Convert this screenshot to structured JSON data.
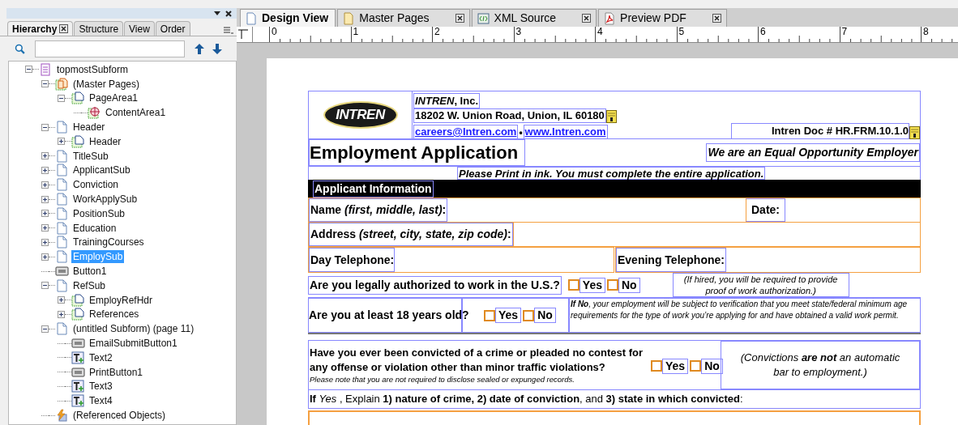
{
  "panel": {
    "tabs": [
      {
        "label": "Hierarchy",
        "selected": true,
        "closable": true
      },
      {
        "label": "Structure",
        "selected": false,
        "closable": false
      },
      {
        "label": "View",
        "selected": false,
        "closable": false
      },
      {
        "label": "Order",
        "selected": false,
        "closable": false
      }
    ],
    "tree": [
      {
        "label": "topmostSubform",
        "kind": "form",
        "expanded": true,
        "selected": false,
        "children": [
          {
            "label": "(Master Pages)",
            "kind": "master",
            "expanded": true,
            "selected": false,
            "children": [
              {
                "label": "PageArea1",
                "kind": "pagearea",
                "expanded": true,
                "selected": false,
                "children": [
                  {
                    "label": "ContentArea1",
                    "kind": "content",
                    "selected": false
                  }
                ]
              }
            ]
          },
          {
            "label": "Header",
            "kind": "subform",
            "expanded": true,
            "selected": false,
            "children": [
              {
                "label": "Header",
                "kind": "pagearea",
                "expanded": false,
                "selected": false
              }
            ]
          },
          {
            "label": "TitleSub",
            "kind": "subform",
            "expanded": false,
            "selected": false
          },
          {
            "label": "ApplicantSub",
            "kind": "subform",
            "expanded": false,
            "selected": false
          },
          {
            "label": "Conviction",
            "kind": "subform",
            "expanded": false,
            "selected": false
          },
          {
            "label": "WorkApplySub",
            "kind": "subform",
            "expanded": false,
            "selected": false
          },
          {
            "label": "PositionSub",
            "kind": "subform",
            "expanded": false,
            "selected": false
          },
          {
            "label": "Education",
            "kind": "subform",
            "expanded": false,
            "selected": false
          },
          {
            "label": "TrainingCourses",
            "kind": "subform",
            "expanded": false,
            "selected": false
          },
          {
            "label": "EmploySub",
            "kind": "subform",
            "expanded": false,
            "selected": true
          },
          {
            "label": "Button1",
            "kind": "button",
            "selected": false
          },
          {
            "label": "RefSub",
            "kind": "subform",
            "expanded": true,
            "selected": false,
            "children": [
              {
                "label": "EmployRefHdr",
                "kind": "pagearea",
                "expanded": false,
                "selected": false
              },
              {
                "label": "References",
                "kind": "pagearea",
                "expanded": false,
                "selected": false
              }
            ]
          },
          {
            "label": "(untitled Subform) (page 11)",
            "kind": "subform",
            "expanded": true,
            "selected": false,
            "children": [
              {
                "label": "EmailSubmitButton1",
                "kind": "button",
                "selected": false
              },
              {
                "label": "Text2",
                "kind": "text",
                "selected": false
              },
              {
                "label": "PrintButton1",
                "kind": "button",
                "selected": false
              },
              {
                "label": "Text3",
                "kind": "text",
                "selected": false
              },
              {
                "label": "Text4",
                "kind": "text",
                "selected": false
              }
            ]
          },
          {
            "label": "(Referenced Objects)",
            "kind": "refs",
            "selected": false
          }
        ]
      }
    ]
  },
  "doc_tabs": [
    {
      "label": "Design View",
      "kind": "page",
      "selected": true,
      "closable": false
    },
    {
      "label": "Master Pages",
      "kind": "master",
      "selected": false,
      "closable": true
    },
    {
      "label": "XML Source",
      "kind": "xml",
      "selected": false,
      "closable": true
    },
    {
      "label": "Preview PDF",
      "kind": "pdf",
      "selected": false,
      "closable": true
    }
  ],
  "ruler": [
    "0",
    "1",
    "2",
    "3",
    "4",
    "5",
    "6",
    "7",
    "8"
  ],
  "form": {
    "logo_text": "INTREN",
    "company": "*INTREN*, Inc.",
    "address": "18202 W. Union Road, Union, IL  60180",
    "email": "careers@Intren.com",
    "separator": "•",
    "website": "www.Intren.com",
    "doc_number": "Intren Doc # HR.FRM.10.1.0",
    "title": "Employment Application",
    "eeo": "We are an Equal Opportunity Employer",
    "instruction": "Please Print in ink. You must complete the entire application.",
    "section": "Applicant Information",
    "name_label": "Name *(first, middle, last)*:",
    "date_label": "Date:",
    "address_label": "Address *(street, city, state, zip code)*:",
    "day_phone_label": "Day Telephone:",
    "evening_phone_label": "Evening Telephone:",
    "questions": [
      {
        "kind": "authorized",
        "text": "Are you legally authorized to work in the U.S.?",
        "options": [
          {
            "label": "Yes",
            "checked": false
          },
          {
            "label": "No",
            "checked": false
          }
        ],
        "note": "(If hired, you will be required to provide proof of work authorization.)"
      },
      {
        "kind": "age",
        "text": "Are you at least 18 years old?",
        "options": [
          {
            "label": "Yes",
            "checked": false
          },
          {
            "label": "No",
            "checked": false
          }
        ],
        "note": "**If No**, your employment will be subject to verification that you meet state/federal minimum age requirements for the type of work you’re applying for and have obtained a valid work permit."
      },
      {
        "kind": "conviction",
        "text": "Have you ever been convicted of a crime or pleaded no contest for any offense or violation other than minor traffic violations?",
        "subnote": "Please note that you are not required to disclose sealed or expunged records.",
        "options": [
          {
            "label": "Yes",
            "checked": false
          },
          {
            "label": "No",
            "checked": false
          }
        ],
        "note": "(Convictions **are not** an automatic bar to employment.)"
      }
    ],
    "explain": "**If** *Yes* , Explain  **1) nature of crime, 2) date of conviction**, and **3) state in which convicted**:"
  }
}
